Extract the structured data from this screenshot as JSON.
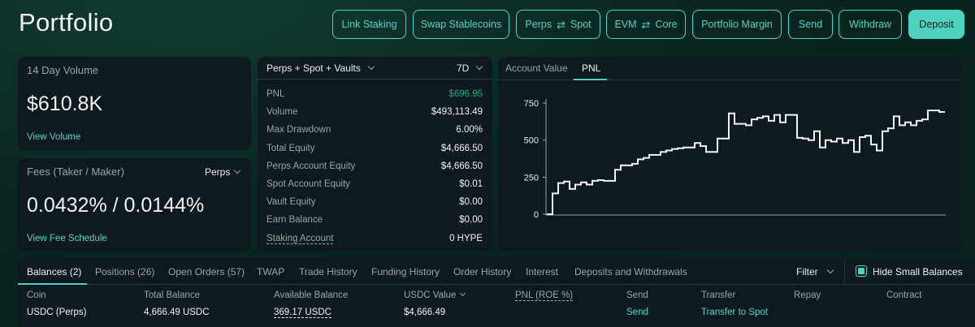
{
  "page": {
    "title": "Portfolio"
  },
  "header_buttons": [
    {
      "label": "Link Staking"
    },
    {
      "label": "Swap Stablecoins"
    },
    {
      "label_left": "Perps",
      "label_right": "Spot"
    },
    {
      "label_left": "EVM",
      "label_right": "Core"
    },
    {
      "label": "Portfolio Margin"
    },
    {
      "label": "Send"
    },
    {
      "label": "Withdraw"
    },
    {
      "label": "Deposit"
    }
  ],
  "volume_card": {
    "label": "14 Day Volume",
    "value": "$610.8K",
    "link": "View Volume"
  },
  "fees_card": {
    "label": "Fees (Taker / Maker)",
    "selector": "Perps",
    "value": "0.0432% / 0.0144%",
    "link": "View Fee Schedule"
  },
  "stats_card": {
    "scope_selector": "Perps + Spot + Vaults",
    "period_selector": "7D",
    "rows": [
      {
        "key": "PNL",
        "value": "$696.95"
      },
      {
        "key": "Volume",
        "value": "$493,113.49"
      },
      {
        "key": "Max Drawdown",
        "value": "6.00%"
      },
      {
        "key": "Total Equity",
        "value": "$4,666.50"
      },
      {
        "key": "Perps Account Equity",
        "value": "$4,666.50"
      },
      {
        "key": "Spot Account Equity",
        "value": "$0.01"
      },
      {
        "key": "Vault Equity",
        "value": "$0.00"
      },
      {
        "key": "Earn Balance",
        "value": "$0.00"
      },
      {
        "key": "Staking Account",
        "value": "0 HYPE"
      }
    ]
  },
  "chart_tabs": {
    "account_value": "Account Value",
    "pnl": "PNL",
    "active": "PNL"
  },
  "chart_data": {
    "type": "line",
    "title": "",
    "xlabel": "",
    "ylabel": "",
    "ylim": [
      0,
      750
    ],
    "yticks": [
      "0",
      "250",
      "500",
      "750"
    ],
    "grid": false,
    "series": [
      {
        "values": [
          0,
          140,
          210,
          220,
          170,
          200,
          215,
          200,
          225,
          230,
          225,
          225,
          300,
          330,
          330,
          340,
          370,
          380,
          400,
          400,
          420,
          430,
          440,
          445,
          450,
          450,
          480,
          460,
          420,
          420,
          510,
          510,
          680,
          610,
          610,
          600,
          640,
          650,
          660,
          630,
          670,
          620,
          670,
          670,
          515,
          510,
          500,
          560,
          450,
          500,
          490,
          510,
          480,
          500,
          420,
          520,
          530,
          470,
          430,
          560,
          580,
          660,
          600,
          620,
          600,
          630,
          640,
          700,
          700,
          690
        ]
      }
    ]
  },
  "bottom_tabs": [
    {
      "label": "Balances (2)"
    },
    {
      "label": "Positions (26)"
    },
    {
      "label": "Open Orders (57)"
    },
    {
      "label": "TWAP"
    },
    {
      "label": "Trade History"
    },
    {
      "label": "Funding History"
    },
    {
      "label": "Order History"
    },
    {
      "label": "Interest"
    },
    {
      "label": "Deposits and Withdrawals"
    }
  ],
  "filter": {
    "label": "Filter"
  },
  "hide_small": {
    "label": "Hide Small Balances",
    "checked": true
  },
  "table": {
    "columns": [
      "Coin",
      "Total Balance",
      "Available Balance",
      "USDC Value",
      "PNL (ROE %)",
      "Send",
      "Transfer",
      "Repay",
      "Contract"
    ],
    "rows": [
      {
        "coin": "USDC (Perps)",
        "total": "4,666.49 USDC",
        "available": "369.17 USDC",
        "usdc_value": "$4,666.49",
        "send": "Send",
        "transfer": "Transfer to Spot"
      }
    ]
  },
  "colors": {
    "accent": "#50d2c1",
    "positive": "#1fa67d",
    "card": "#0f1a1e"
  }
}
